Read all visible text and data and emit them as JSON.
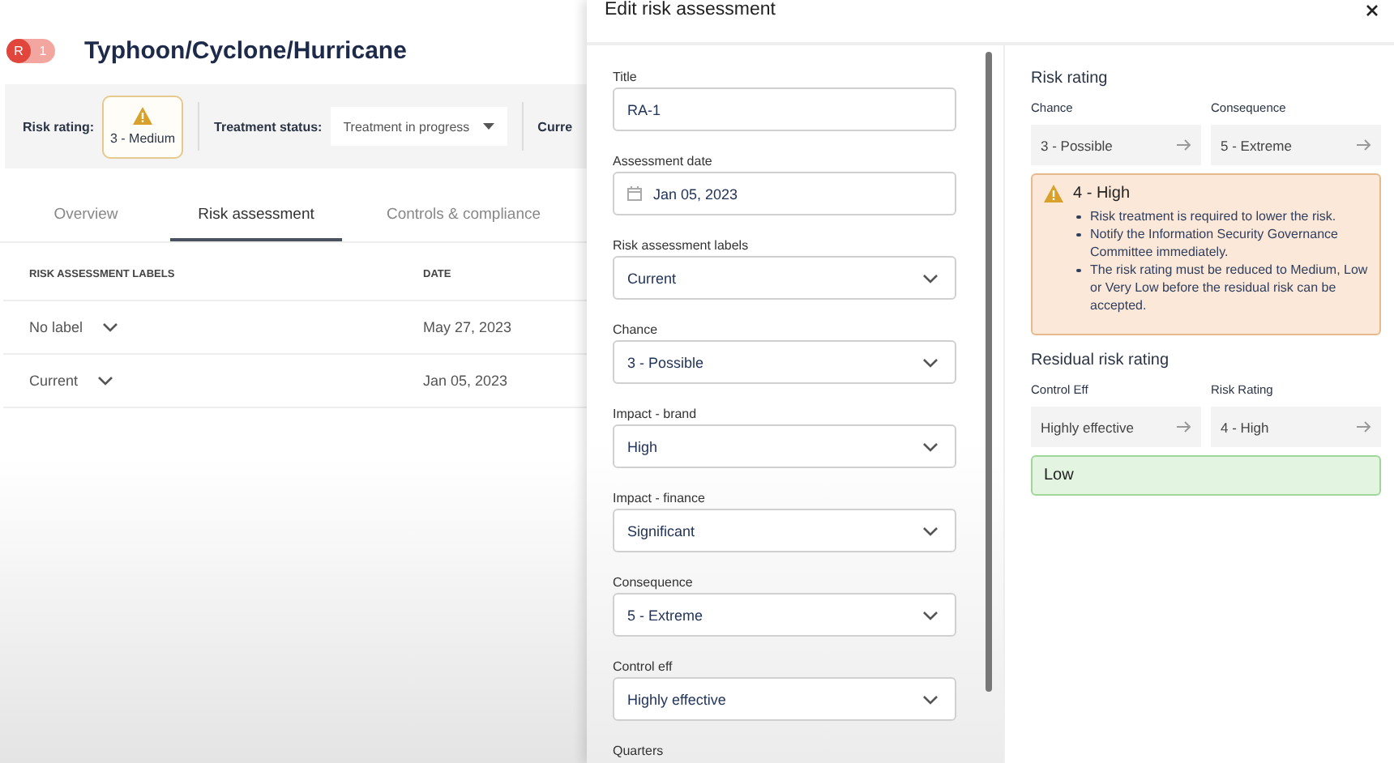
{
  "header": {
    "badge": {
      "letter": "R",
      "count": "1"
    },
    "title": "Typhoon/Cyclone/Hurricane"
  },
  "summary": {
    "risk_rating_label": "Risk rating:",
    "risk_rating": "3 - Medium",
    "treatment_label": "Treatment status:",
    "treatment_value": "Treatment in progress",
    "next_label": "Curre"
  },
  "tabs": [
    {
      "label": "Overview",
      "selected": false
    },
    {
      "label": "Risk assessment",
      "selected": true
    },
    {
      "label": "Controls & compliance",
      "selected": false
    }
  ],
  "table": {
    "columns": [
      "RISK ASSESSMENT LABELS",
      "DATE"
    ],
    "rows": [
      {
        "label": "No label",
        "date": "May 27, 2023"
      },
      {
        "label": "Current",
        "date": "Jan 05, 2023"
      }
    ]
  },
  "panel": {
    "title": "Edit risk assessment",
    "fields": [
      {
        "label": "Title",
        "kind": "text",
        "value": "RA-1"
      },
      {
        "label": "Assessment date",
        "kind": "date",
        "value": "Jan 05, 2023"
      },
      {
        "label": "Risk assessment labels",
        "kind": "select",
        "value": "Current"
      },
      {
        "label": "Chance",
        "kind": "select",
        "value": "3 - Possible"
      },
      {
        "label": "Impact - brand",
        "kind": "select",
        "value": "High"
      },
      {
        "label": "Impact - finance",
        "kind": "select",
        "value": "Significant"
      },
      {
        "label": "Consequence",
        "kind": "select",
        "value": "5 - Extreme"
      },
      {
        "label": "Control eff",
        "kind": "select",
        "value": "Highly effective"
      }
    ],
    "next_label": "Quarters",
    "ratings": [
      {
        "title": "Risk rating",
        "inputs": [
          {
            "label": "Chance",
            "value": "3 - Possible"
          },
          {
            "label": "Consequence",
            "value": "5 - Extreme"
          }
        ],
        "result": {
          "kind": "warning",
          "value": "4 - High",
          "notes": [
            "Risk treatment is required to lower the risk.",
            "Notify the Information Security Governance Committee immediately.",
            "The risk rating must be reduced to Medium, Low or Very Low before the residual risk can be accepted."
          ]
        }
      },
      {
        "title": "Residual risk rating",
        "inputs": [
          {
            "label": "Control Eff",
            "value": "Highly effective"
          },
          {
            "label": "Risk Rating",
            "value": "4 - High"
          }
        ],
        "result": {
          "kind": "success",
          "value": "Low"
        }
      }
    ]
  }
}
